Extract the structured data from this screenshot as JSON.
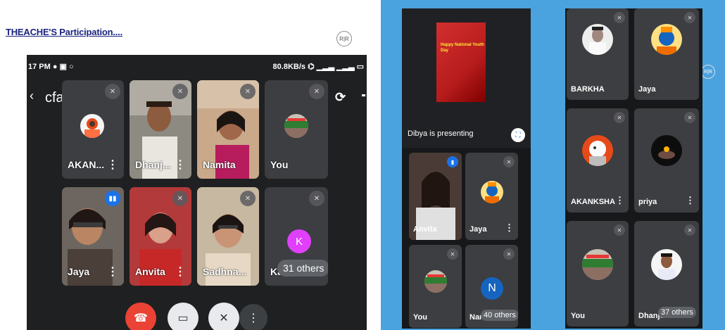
{
  "left": {
    "doc_title": "THEACHE'S Participation....",
    "watermark": "R|R",
    "status_left": "17 PM",
    "status_right": "80.8KB/s",
    "meeting_code": "cfa-byqp-btj",
    "tiles": [
      {
        "name": "AKAN...",
        "mic": "muted"
      },
      {
        "name": "Dhanj...",
        "mic": "muted"
      },
      {
        "name": "Namita",
        "mic": "muted"
      },
      {
        "name": "You",
        "mic": "muted"
      },
      {
        "name": "Jaya",
        "mic": "active"
      },
      {
        "name": "Anvita",
        "mic": "muted"
      },
      {
        "name": "Sadhna...",
        "mic": "muted"
      },
      {
        "name": "Ka",
        "mic": "muted"
      }
    ],
    "others_label": "31 others",
    "k_initial": "K"
  },
  "right": {
    "presenting_label": "Dibya is presenting",
    "slide_text": "Happy National Youth Day",
    "watermark": "R|R",
    "left_tiles": [
      {
        "name": "Anvita",
        "mic": "active"
      },
      {
        "name": "Jaya",
        "mic": "muted"
      },
      {
        "name": "You",
        "mic": "muted"
      },
      {
        "name": "Nar",
        "mic": "muted"
      }
    ],
    "left_others": "40 others",
    "n_initial": "N",
    "right_tiles": [
      {
        "name": "BARKHA",
        "mic": "muted"
      },
      {
        "name": "Jaya",
        "mic": "muted"
      },
      {
        "name": "AKANKSHA",
        "mic": "muted"
      },
      {
        "name": "priya",
        "mic": "muted"
      },
      {
        "name": "You",
        "mic": "muted"
      },
      {
        "name": "Dhanje",
        "mic": "muted"
      }
    ],
    "right_others": "37 others"
  },
  "colors": {
    "meet_bg": "#1f2021",
    "tile_bg": "#3c3e41",
    "active_mic": "#1a73e8",
    "end_call": "#ea4335",
    "right_bg": "#4aa3df",
    "k_avatar": "#e040fb"
  }
}
